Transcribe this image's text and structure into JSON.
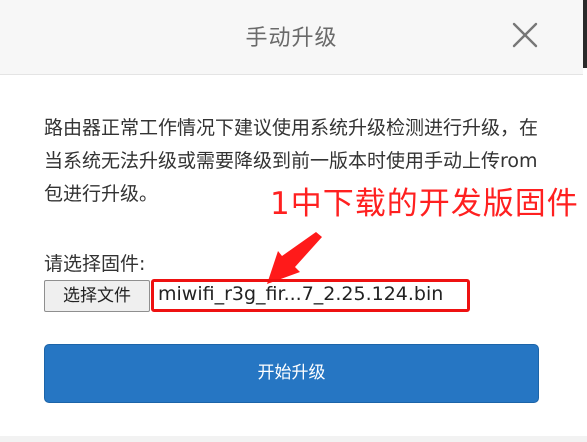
{
  "dialog": {
    "title": "手动升级",
    "close_icon": "close-icon"
  },
  "description": "路由器正常工作情况下建议使用系统升级检测进行升级，在当系统无法升级或需要降级到前一版本时使用手动上传rom包进行升级。",
  "annotation": {
    "text": "1中下载的开发版固件",
    "color": "#ff2020",
    "arrow_icon": "red-arrow-icon"
  },
  "file": {
    "label": "请选择固件:",
    "choose_button": "选择文件",
    "selected_name": "miwifi_r3g_fir...7_2.25.124.bin"
  },
  "actions": {
    "start_label": "开始升级"
  },
  "colors": {
    "primary": "#2676c3",
    "highlight": "#ee1111"
  }
}
